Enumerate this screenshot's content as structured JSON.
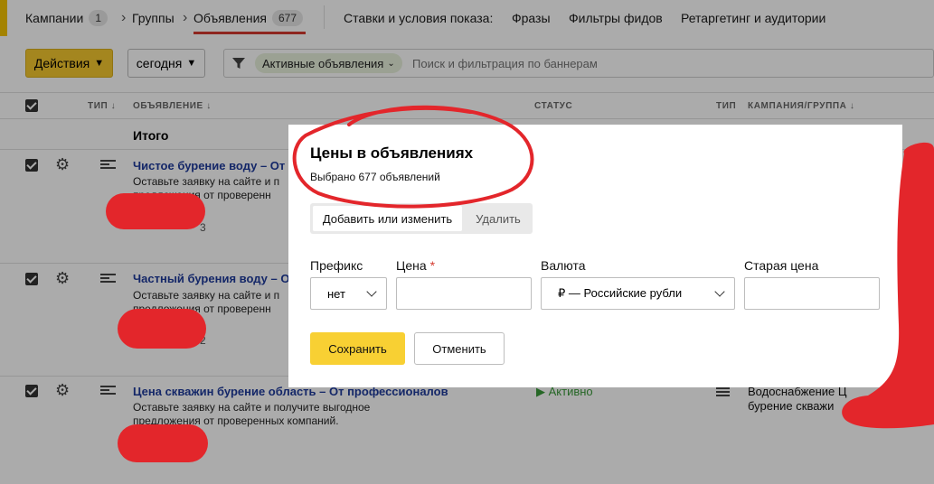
{
  "breadcrumbs": {
    "campaigns_label": "Кампании",
    "campaigns_count": "1",
    "groups_label": "Группы",
    "ads_label": "Объявления",
    "ads_count": "677"
  },
  "top_tabs": [
    "Ставки и условия показа:",
    "Фразы",
    "Фильтры фидов",
    "Ретаргетинг и аудитории"
  ],
  "toolbar": {
    "actions_label": "Действия",
    "date_label": "сегодня",
    "filter_chip": "Активные объявления",
    "search_placeholder": "Поиск и фильтрация по баннерам"
  },
  "table": {
    "headers": {
      "type": "ТИП",
      "ad": "ОБЪЯВЛЕНИЕ",
      "status": "СТАТУС",
      "type2": "ТИП",
      "campaign": "КАМПАНИЯ/ГРУППА"
    },
    "total_label": "Итого",
    "rows": [
      {
        "title": "Чистое бурение воду – От",
        "text_line1": "Оставьте заявку на сайте и п",
        "text_line2": "предложения от проверенн",
        "id_tail": "3"
      },
      {
        "title": "Частный бурения воду – О",
        "text_line1": "Оставьте заявку на сайте и п",
        "text_line2": "предложения от проверенн",
        "id_tail": "2"
      },
      {
        "title": "Цена скважин бурение область – От профессионалов",
        "text_line1": "Оставьте заявку на сайте и получите выгодное",
        "text_line2": "предложения от проверенных компаний.",
        "status": "Активно",
        "campaign_line1": "Водоснабжение Ц",
        "campaign_line2": "бурение скважи"
      }
    ]
  },
  "modal": {
    "title": "Цены в объявлениях",
    "subtitle": "Выбрано 677 объявлений",
    "tab_add": "Добавить или изменить",
    "tab_delete": "Удалить",
    "prefix_label": "Префикс",
    "prefix_value": "нет",
    "price_label": "Цена",
    "price_required": "*",
    "price_value": "",
    "currency_label": "Валюта",
    "currency_value": "₽ — Российские рубли",
    "old_price_label": "Старая цена",
    "old_price_value": "",
    "save_label": "Сохранить",
    "cancel_label": "Отменить"
  },
  "colors": {
    "accent_yellow": "#f8d033",
    "link_blue": "#1f3b9c",
    "status_green": "#3a9a3a",
    "annotation_red": "#e3262b"
  }
}
